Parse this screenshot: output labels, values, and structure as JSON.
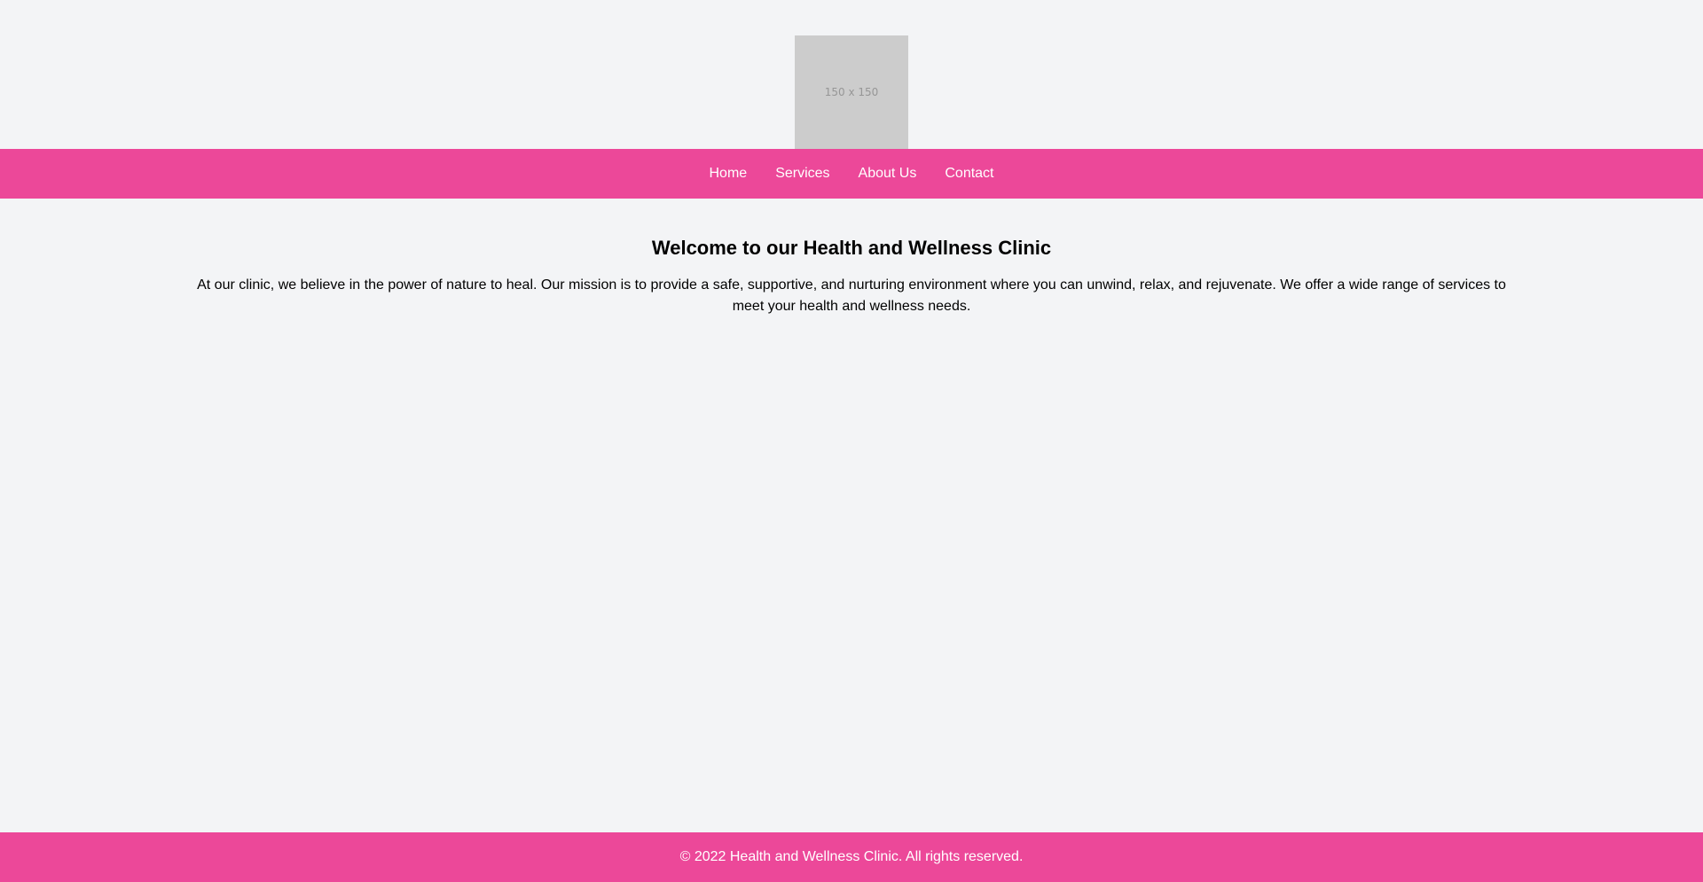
{
  "header": {
    "logo_text": "150 x 150"
  },
  "nav": {
    "items": [
      {
        "label": "Home"
      },
      {
        "label": "Services"
      },
      {
        "label": "About Us"
      },
      {
        "label": "Contact"
      }
    ]
  },
  "main": {
    "title": "Welcome to our Health and Wellness Clinic",
    "intro": "At our clinic, we believe in the power of nature to heal. Our mission is to provide a safe, supportive, and nurturing environment where you can unwind, relax, and rejuvenate. We offer a wide range of services to meet your health and wellness needs."
  },
  "footer": {
    "copyright": "© 2022 Health and Wellness Clinic. All rights reserved."
  },
  "colors": {
    "accent": "#ec4899",
    "background": "#f3f4f6",
    "placeholder": "#cccccc"
  }
}
